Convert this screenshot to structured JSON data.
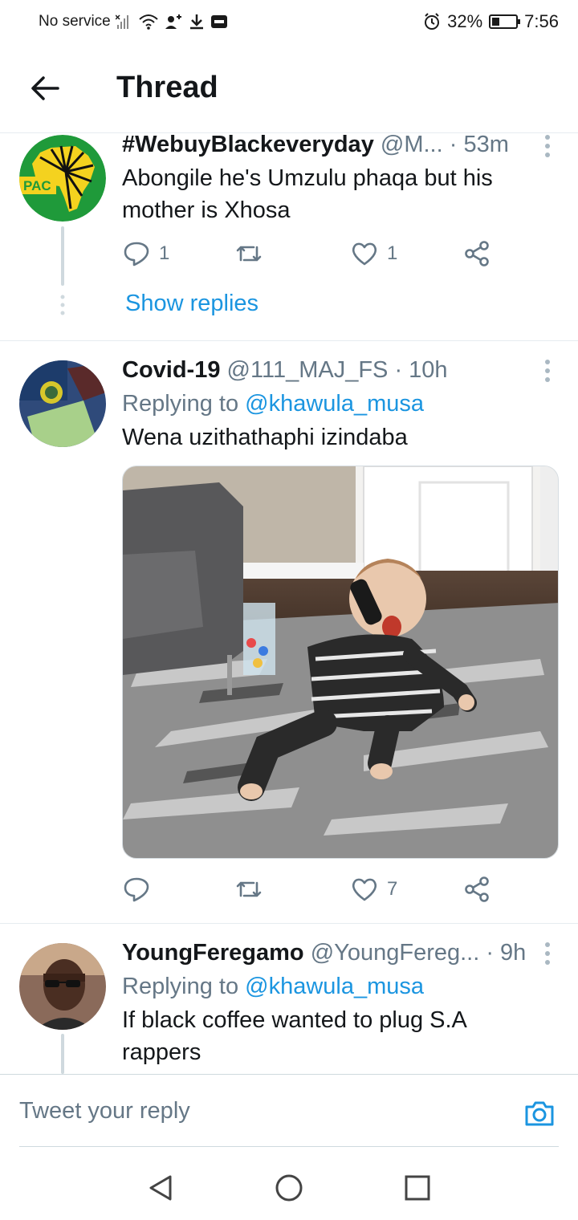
{
  "status_bar": {
    "carrier": "No service",
    "battery_percent": "32%",
    "battery_level": 0.32,
    "time": "7:56"
  },
  "header": {
    "title": "Thread"
  },
  "tweets": [
    {
      "name": "#WebuyBlackeveryday",
      "handle": "@M...",
      "time": "· 53m",
      "text": "Abongile he's Umzulu phaqa but his mother is Xhosa",
      "avatar_label": "PAC",
      "reply_count": "1",
      "retweet_count": "",
      "like_count": "1",
      "show_replies": "Show replies"
    },
    {
      "name": "Covid-19",
      "handle": "@111_MAJ_FS",
      "time": "· 10h",
      "replying_prefix": "Replying to",
      "replying_to": "@khawula_musa",
      "text": "Wena uzithathaphi izindaba",
      "reply_count": "",
      "retweet_count": "",
      "like_count": "7"
    },
    {
      "name": "YoungFeregamo",
      "handle": "@YoungFereg...",
      "time": "· 9h",
      "replying_prefix": "Replying to",
      "replying_to": "@khawula_musa",
      "text": "If black coffee wanted to plug S.A rappers"
    }
  ],
  "compose": {
    "placeholder": "Tweet your reply"
  },
  "colors": {
    "accent": "#1b95e0",
    "text": "#14171a",
    "secondary": "#657786",
    "pac_green": "#1f9a3a",
    "pac_yellow": "#f4d21f"
  },
  "icons": {
    "back": "arrow-left-icon",
    "reply": "reply-bubble-icon",
    "retweet": "retweet-icon",
    "like": "heart-icon",
    "share": "share-icon",
    "more": "vertical-dots-icon",
    "camera": "camera-icon",
    "nav_back": "triangle-back-icon",
    "nav_home": "circle-home-icon",
    "nav_recent": "square-recent-icon"
  }
}
